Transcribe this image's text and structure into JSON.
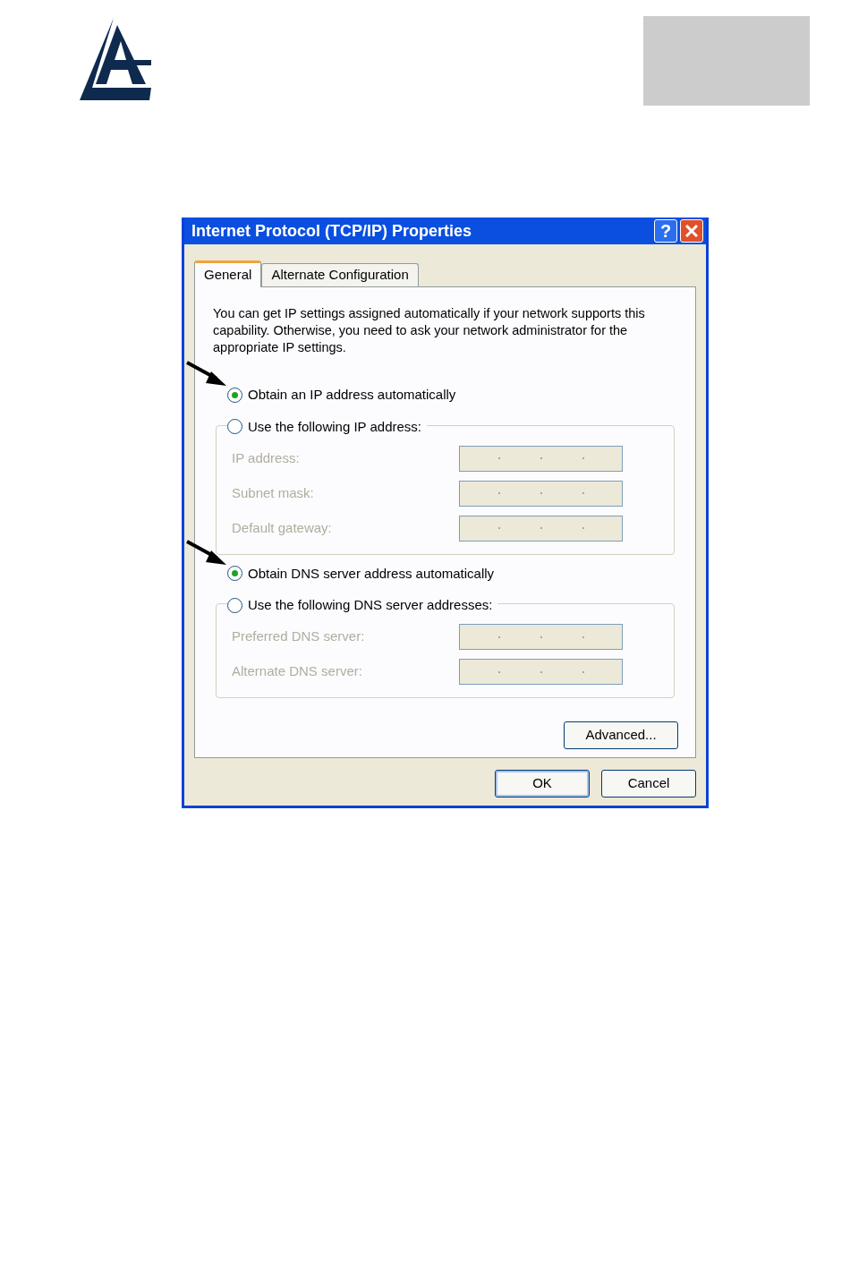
{
  "dialog": {
    "title": "Internet Protocol (TCP/IP) Properties",
    "help_button": "?",
    "tabs": [
      {
        "label": "General",
        "selected": true
      },
      {
        "label": "Alternate Configuration",
        "selected": false
      }
    ],
    "description": "You can get IP settings assigned automatically if your network supports this capability. Otherwise, you need to ask your network administrator for the appropriate IP settings.",
    "sections": [
      {
        "options": [
          {
            "label": "Obtain an IP address automatically",
            "selected": true,
            "annotated": true
          },
          {
            "label": "Use the following IP address:",
            "selected": false,
            "annotated": false
          }
        ],
        "fields": [
          {
            "label": "IP address:",
            "disabled": true
          },
          {
            "label": "Subnet mask:",
            "disabled": true
          },
          {
            "label": "Default gateway:",
            "disabled": true
          }
        ]
      },
      {
        "options": [
          {
            "label": "Obtain DNS server address automatically",
            "selected": true,
            "annotated": true
          },
          {
            "label": "Use the following DNS server addresses:",
            "selected": false,
            "annotated": false
          }
        ],
        "fields": [
          {
            "label": "Preferred DNS server:",
            "disabled": true
          },
          {
            "label": "Alternate DNS server:",
            "disabled": true
          }
        ]
      }
    ],
    "advanced_button": "Advanced...",
    "buttons": [
      {
        "label": "OK",
        "default": true
      },
      {
        "label": "Cancel",
        "default": false
      }
    ]
  }
}
